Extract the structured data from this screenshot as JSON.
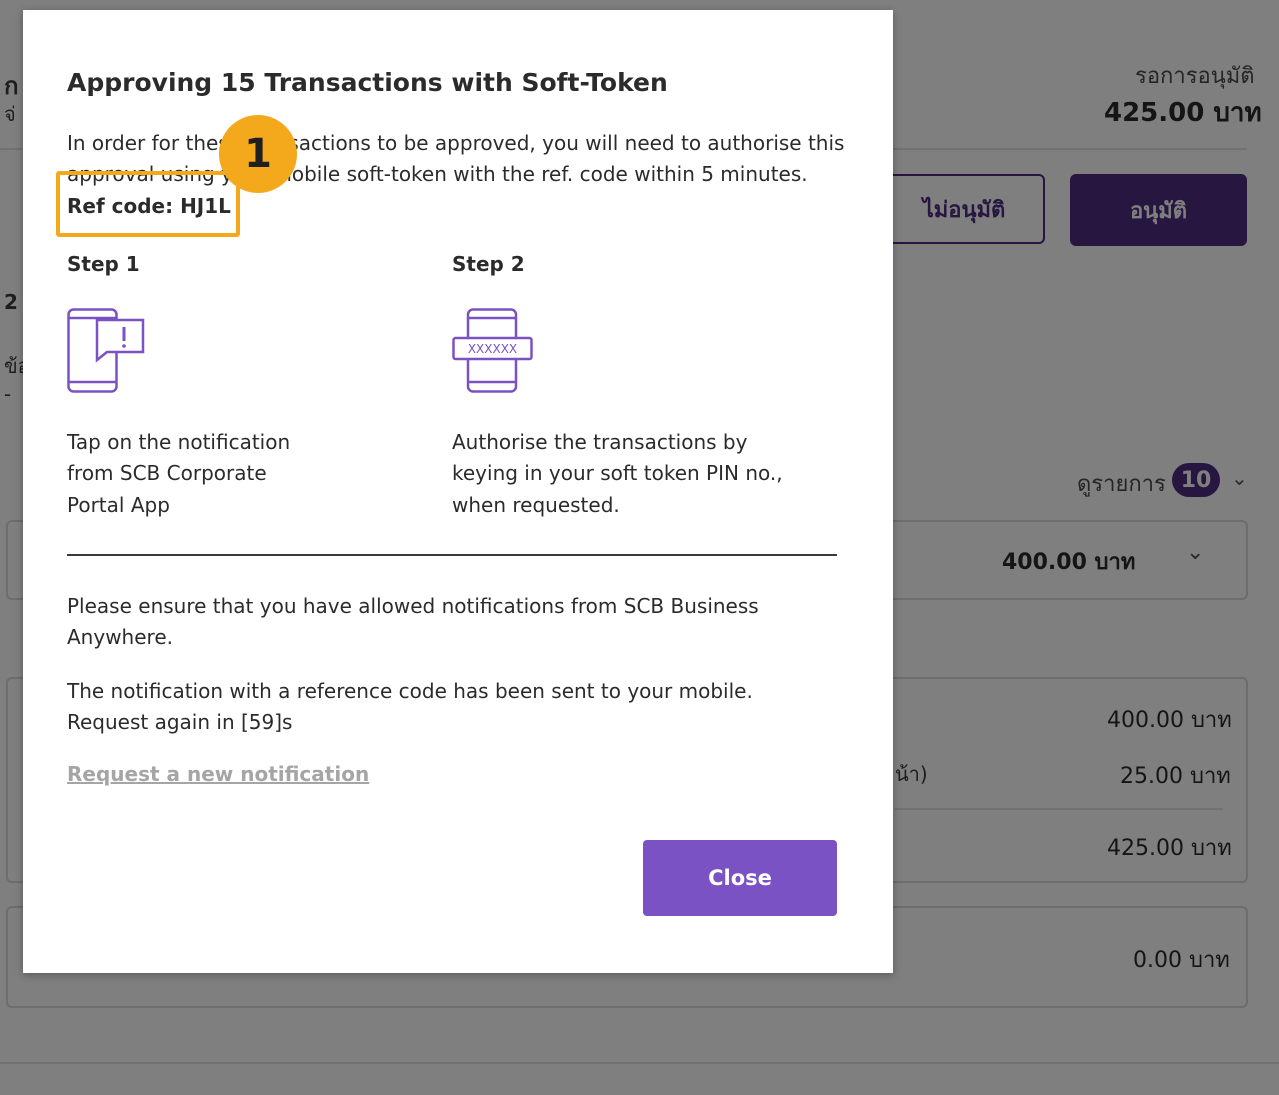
{
  "background": {
    "status_label": "รอการอนุมัติ",
    "total_amount": "425.00 บาท",
    "left_char_1": "ก",
    "left_char_2": "จ่",
    "left_char_3": "2",
    "left_char_4": "ข้อ",
    "left_char_5": "-",
    "reject_button": "ไม่อนุมัติ",
    "approve_button": "อนุมัติ",
    "view_items_label": "ดูรายการ",
    "view_items_count": "10",
    "row_amount": "400.00 บาท",
    "summary": {
      "line1_amount": "400.00 บาท",
      "line2_label_fragment": "น้า)",
      "line2_amount": "25.00 บาท",
      "total_amount": "425.00 บาท"
    },
    "extra_amount": "0.00 บาท"
  },
  "modal": {
    "title": "Approving 15 Transactions with Soft-Token",
    "intro_line1": "In order for these transactions to be approved, you will need to authorise this",
    "intro_line2": "approval using your mobile soft-token with the ref. code within 5 minutes.",
    "ref_code": "Ref code: HJ1L",
    "step1": {
      "label": "Step 1",
      "line1": "Tap on the notification",
      "line2": "from SCB Corporate",
      "line3": "Portal App",
      "icon": "phone-notification-icon"
    },
    "step2": {
      "label": "Step 2",
      "line1": "Authorise the transactions by",
      "line2": "keying in your soft token PIN no.,",
      "line3": "when requested.",
      "icon": "phone-pin-icon",
      "pin_text": "XXXXXX"
    },
    "ensure_line1": "Please ensure that you have allowed notifications from SCB Business",
    "ensure_line2": "Anywhere.",
    "sent_line1": "The notification with a reference code has been sent to your mobile.",
    "sent_line2": "Request again in [59]s",
    "request_link": "Request a new notification",
    "close_button": "Close"
  },
  "annotation": {
    "number": "1"
  },
  "colors": {
    "brand_purple": "#4f2d7f",
    "close_button": "#7a52c4",
    "annotation": "#f4a81c"
  }
}
